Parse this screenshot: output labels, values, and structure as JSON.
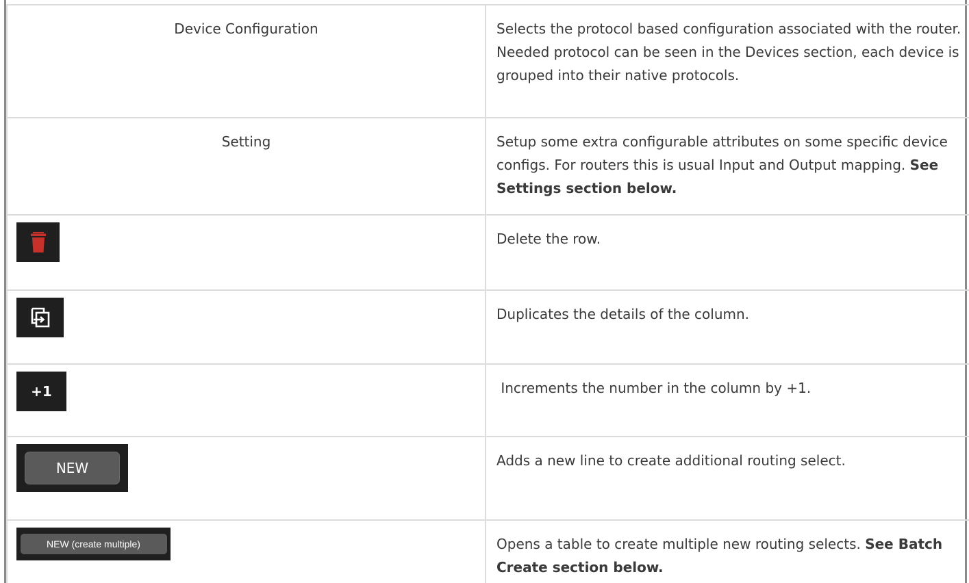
{
  "rows": [
    {
      "left_text": "Device Configuration",
      "description": "Selects the protocol based configuration associated with the router. Needed protocol can be seen in the Devices section, each device is grouped into their native protocols."
    },
    {
      "left_text": "Setting",
      "description": "Setup some extra configurable attributes on some specific device configs. For routers this is usual Input and Output mapping.  ",
      "description_bold": "See Settings section below."
    },
    {
      "icon": "trash-icon",
      "icon_color": "#c8312a",
      "description": "Delete the row."
    },
    {
      "icon": "duplicate-icon",
      "description": "Duplicates the details of the column."
    },
    {
      "icon_label": "+1",
      "description": " Increments the number in the column by +1."
    },
    {
      "button_label": "NEW",
      "description": "Adds a new line to create additional routing select."
    },
    {
      "button_label": "NEW (create multiple)",
      "description": "Opens a table to create multiple new routing selects. ",
      "description_bold": "See Batch Create section below."
    }
  ]
}
